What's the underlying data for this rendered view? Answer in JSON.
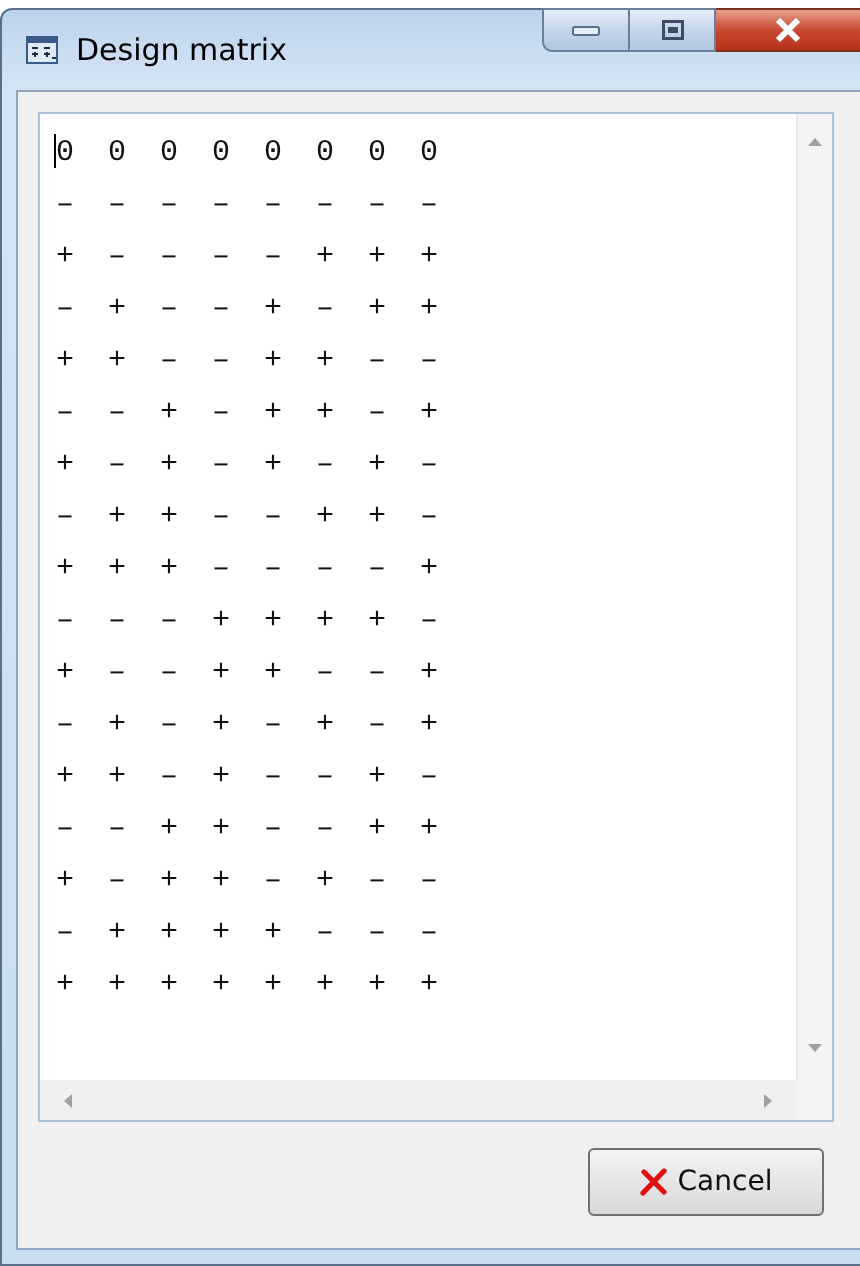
{
  "window": {
    "title": "Design matrix",
    "controls": [
      {
        "kind": "minimize"
      },
      {
        "kind": "maximize"
      },
      {
        "kind": "close"
      }
    ]
  },
  "matrix": {
    "lines": [
      "0 0 0 0 0 0 0 0",
      "– – – – – – – –",
      "+ – – – – + + +",
      "– + – – + – + +",
      "+ + – – + + – –",
      "– – + – + + – +",
      "+ – + – + – + –",
      "– + + – – + + –",
      "+ + + – – – – +",
      "– – – + + + + –",
      "+ – – + + – – +",
      "– + – + – + – +",
      "+ + – + – – + –",
      "– – + + – – + +",
      "+ – + + – + – –",
      "– + + + + – – –",
      "+ + + + + + + +"
    ]
  },
  "buttons": [
    {
      "kind": "cancel",
      "label": "Cancel"
    }
  ]
}
